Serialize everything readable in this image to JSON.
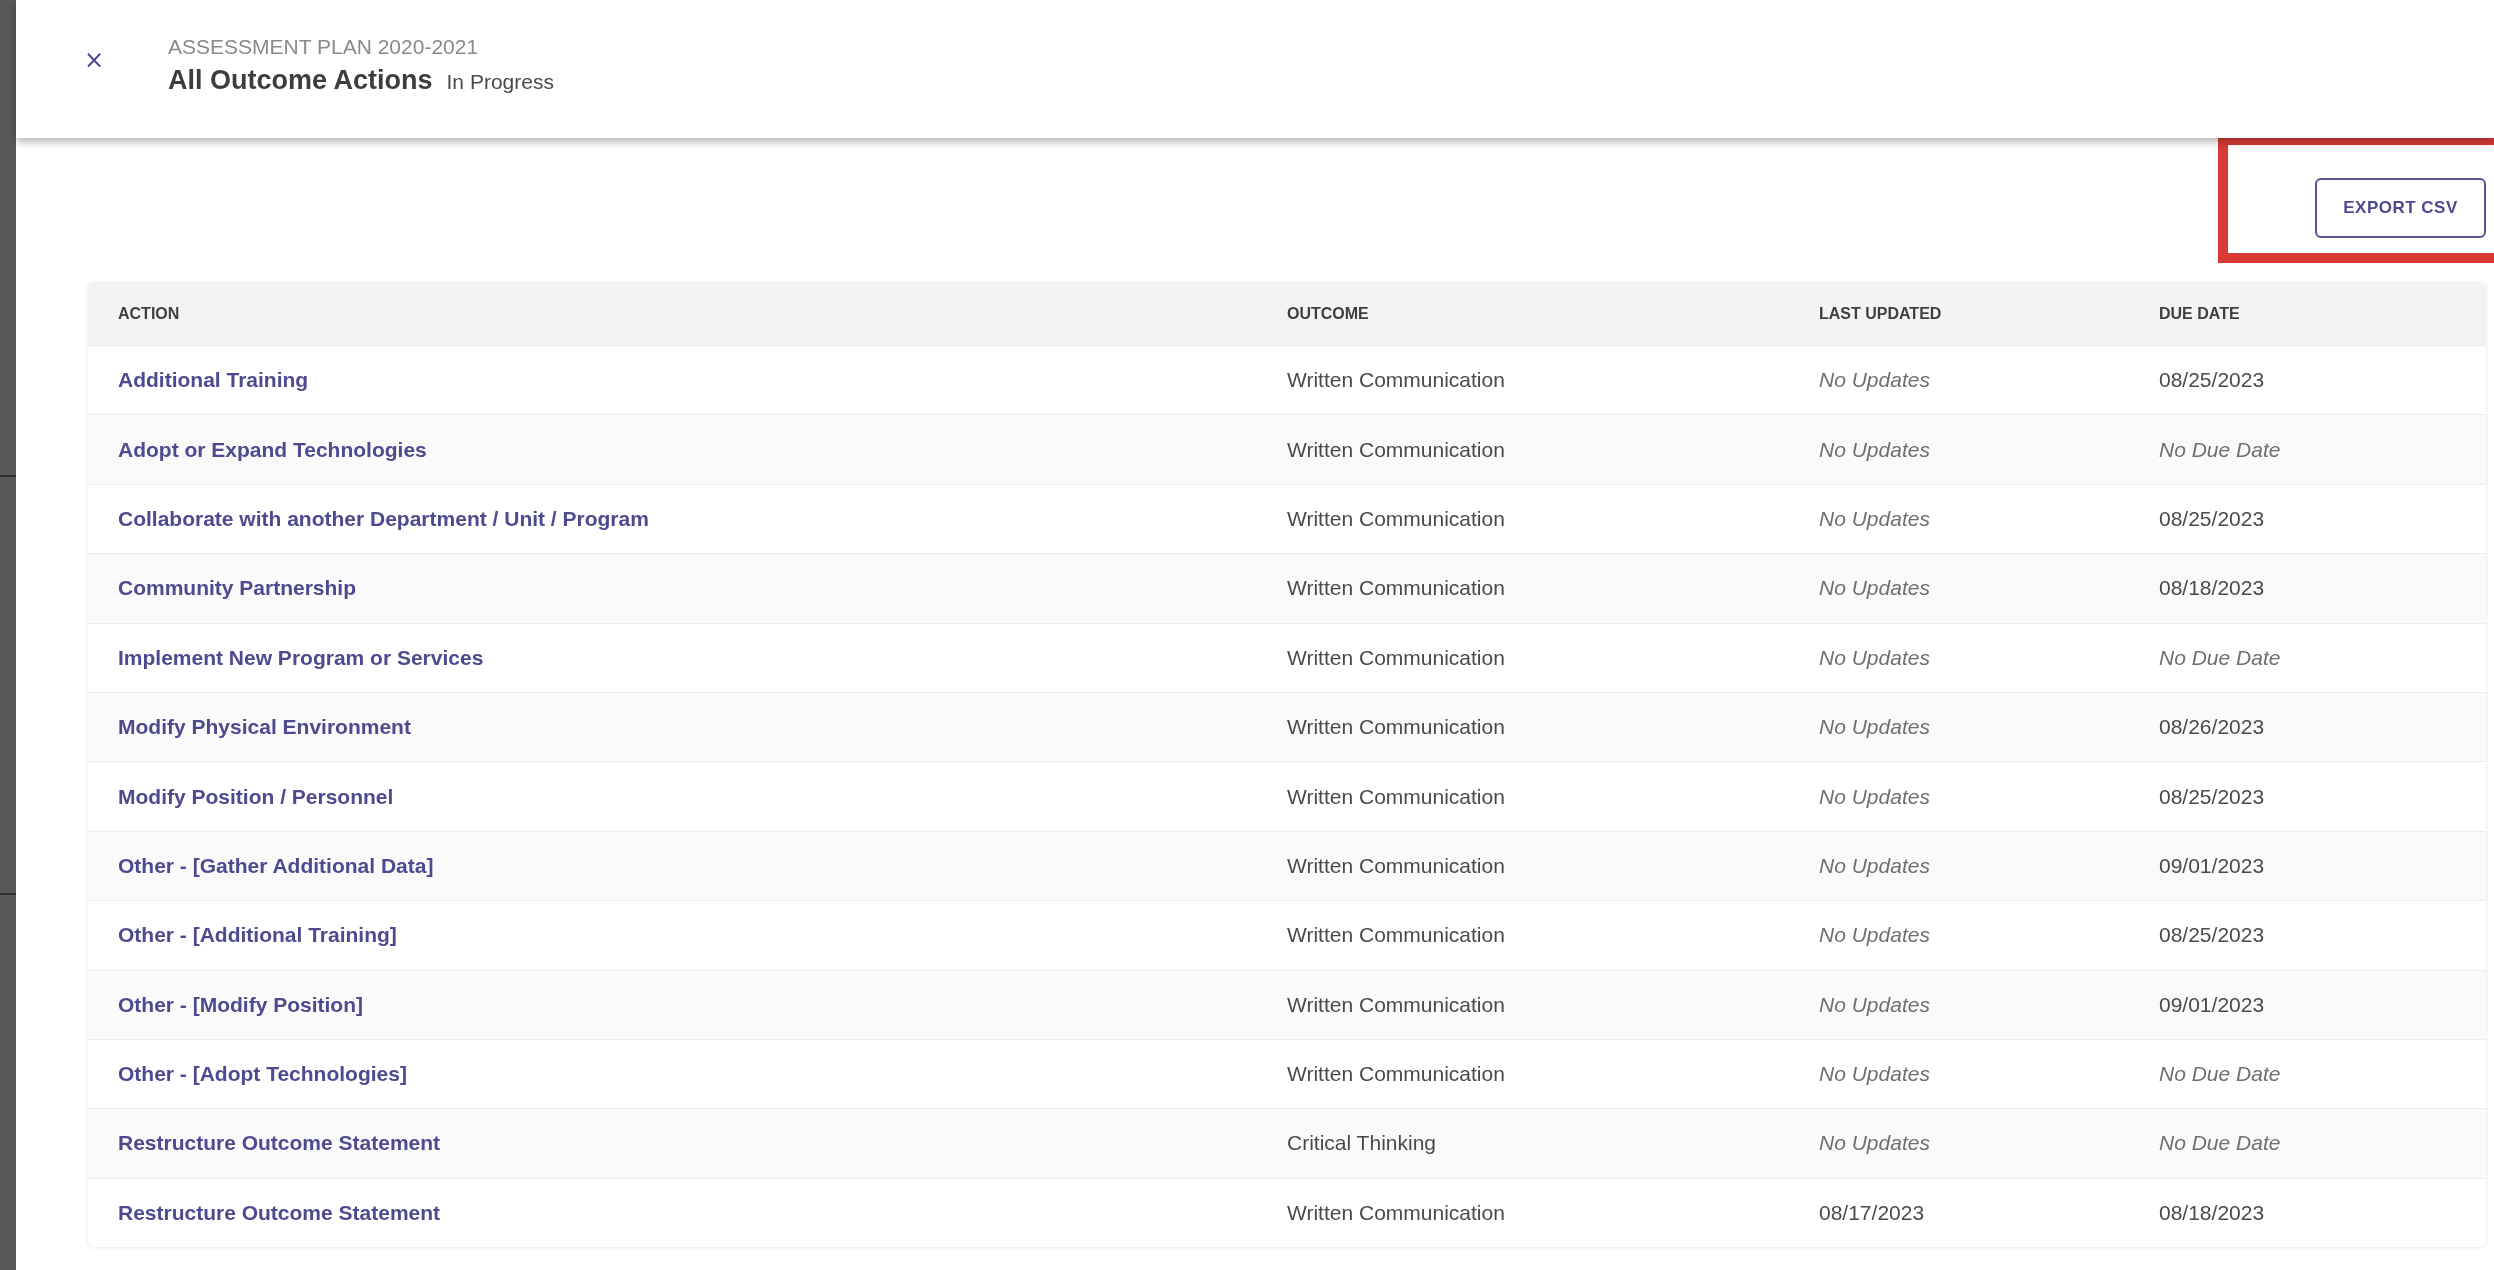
{
  "header": {
    "eyebrow": "ASSESSMENT PLAN 2020-2021",
    "title": "All Outcome Actions",
    "status": "In Progress",
    "close": "×"
  },
  "export_button": {
    "label": "EXPORT CSV",
    "highlighted": true
  },
  "table": {
    "columns": [
      "ACTION",
      "OUTCOME",
      "LAST UPDATED",
      "DUE DATE"
    ],
    "rows": [
      {
        "action": "Additional Training",
        "outcome": "Written Communication",
        "last_updated": {
          "text": "No Updates",
          "kind": "none"
        },
        "due_date": {
          "text": "08/25/2023",
          "kind": "date"
        }
      },
      {
        "action": "Adopt or Expand Technologies",
        "outcome": "Written Communication",
        "last_updated": {
          "text": "No Updates",
          "kind": "none"
        },
        "due_date": {
          "text": "No Due Date",
          "kind": "none"
        }
      },
      {
        "action": "Collaborate with another Department / Unit / Program",
        "outcome": "Written Communication",
        "last_updated": {
          "text": "No Updates",
          "kind": "none"
        },
        "due_date": {
          "text": "08/25/2023",
          "kind": "date"
        }
      },
      {
        "action": "Community Partnership",
        "outcome": "Written Communication",
        "last_updated": {
          "text": "No Updates",
          "kind": "none"
        },
        "due_date": {
          "text": "08/18/2023",
          "kind": "date"
        }
      },
      {
        "action": "Implement New Program or Services",
        "outcome": "Written Communication",
        "last_updated": {
          "text": "No Updates",
          "kind": "none"
        },
        "due_date": {
          "text": "No Due Date",
          "kind": "none"
        }
      },
      {
        "action": "Modify Physical Environment",
        "outcome": "Written Communication",
        "last_updated": {
          "text": "No Updates",
          "kind": "none"
        },
        "due_date": {
          "text": "08/26/2023",
          "kind": "date"
        }
      },
      {
        "action": "Modify Position / Personnel",
        "outcome": "Written Communication",
        "last_updated": {
          "text": "No Updates",
          "kind": "none"
        },
        "due_date": {
          "text": "08/25/2023",
          "kind": "date"
        }
      },
      {
        "action": "Other - [Gather Additional Data]",
        "outcome": "Written Communication",
        "last_updated": {
          "text": "No Updates",
          "kind": "none"
        },
        "due_date": {
          "text": "09/01/2023",
          "kind": "date"
        }
      },
      {
        "action": "Other - [Additional Training]",
        "outcome": "Written Communication",
        "last_updated": {
          "text": "No Updates",
          "kind": "none"
        },
        "due_date": {
          "text": "08/25/2023",
          "kind": "date"
        }
      },
      {
        "action": "Other - [Modify Position]",
        "outcome": "Written Communication",
        "last_updated": {
          "text": "No Updates",
          "kind": "none"
        },
        "due_date": {
          "text": "09/01/2023",
          "kind": "date"
        }
      },
      {
        "action": "Other - [Adopt Technologies]",
        "outcome": "Written Communication",
        "last_updated": {
          "text": "No Updates",
          "kind": "none"
        },
        "due_date": {
          "text": "No Due Date",
          "kind": "none"
        }
      },
      {
        "action": "Restructure Outcome Statement",
        "outcome": "Critical Thinking",
        "last_updated": {
          "text": "No Updates",
          "kind": "none"
        },
        "due_date": {
          "text": "No Due Date",
          "kind": "none"
        }
      },
      {
        "action": "Restructure Outcome Statement",
        "outcome": "Written Communication",
        "last_updated": {
          "text": "08/17/2023",
          "kind": "date"
        },
        "due_date": {
          "text": "08/18/2023",
          "kind": "date"
        }
      }
    ]
  }
}
